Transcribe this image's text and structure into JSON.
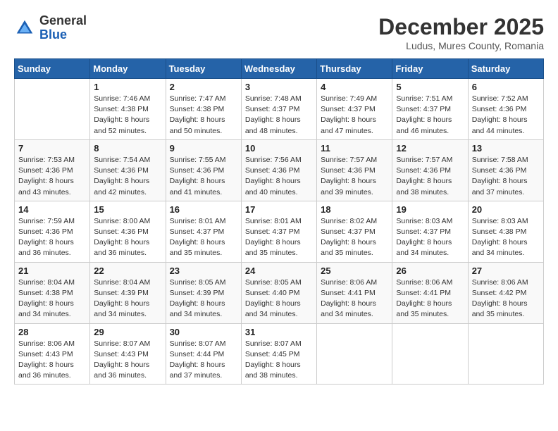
{
  "logo": {
    "general": "General",
    "blue": "Blue"
  },
  "title": {
    "month": "December 2025",
    "location": "Ludus, Mures County, Romania"
  },
  "header_days": [
    "Sunday",
    "Monday",
    "Tuesday",
    "Wednesday",
    "Thursday",
    "Friday",
    "Saturday"
  ],
  "weeks": [
    [
      {
        "day": "",
        "info": ""
      },
      {
        "day": "1",
        "info": "Sunrise: 7:46 AM\nSunset: 4:38 PM\nDaylight: 8 hours\nand 52 minutes."
      },
      {
        "day": "2",
        "info": "Sunrise: 7:47 AM\nSunset: 4:38 PM\nDaylight: 8 hours\nand 50 minutes."
      },
      {
        "day": "3",
        "info": "Sunrise: 7:48 AM\nSunset: 4:37 PM\nDaylight: 8 hours\nand 48 minutes."
      },
      {
        "day": "4",
        "info": "Sunrise: 7:49 AM\nSunset: 4:37 PM\nDaylight: 8 hours\nand 47 minutes."
      },
      {
        "day": "5",
        "info": "Sunrise: 7:51 AM\nSunset: 4:37 PM\nDaylight: 8 hours\nand 46 minutes."
      },
      {
        "day": "6",
        "info": "Sunrise: 7:52 AM\nSunset: 4:36 PM\nDaylight: 8 hours\nand 44 minutes."
      }
    ],
    [
      {
        "day": "7",
        "info": "Sunrise: 7:53 AM\nSunset: 4:36 PM\nDaylight: 8 hours\nand 43 minutes."
      },
      {
        "day": "8",
        "info": "Sunrise: 7:54 AM\nSunset: 4:36 PM\nDaylight: 8 hours\nand 42 minutes."
      },
      {
        "day": "9",
        "info": "Sunrise: 7:55 AM\nSunset: 4:36 PM\nDaylight: 8 hours\nand 41 minutes."
      },
      {
        "day": "10",
        "info": "Sunrise: 7:56 AM\nSunset: 4:36 PM\nDaylight: 8 hours\nand 40 minutes."
      },
      {
        "day": "11",
        "info": "Sunrise: 7:57 AM\nSunset: 4:36 PM\nDaylight: 8 hours\nand 39 minutes."
      },
      {
        "day": "12",
        "info": "Sunrise: 7:57 AM\nSunset: 4:36 PM\nDaylight: 8 hours\nand 38 minutes."
      },
      {
        "day": "13",
        "info": "Sunrise: 7:58 AM\nSunset: 4:36 PM\nDaylight: 8 hours\nand 37 minutes."
      }
    ],
    [
      {
        "day": "14",
        "info": "Sunrise: 7:59 AM\nSunset: 4:36 PM\nDaylight: 8 hours\nand 36 minutes."
      },
      {
        "day": "15",
        "info": "Sunrise: 8:00 AM\nSunset: 4:36 PM\nDaylight: 8 hours\nand 36 minutes."
      },
      {
        "day": "16",
        "info": "Sunrise: 8:01 AM\nSunset: 4:37 PM\nDaylight: 8 hours\nand 35 minutes."
      },
      {
        "day": "17",
        "info": "Sunrise: 8:01 AM\nSunset: 4:37 PM\nDaylight: 8 hours\nand 35 minutes."
      },
      {
        "day": "18",
        "info": "Sunrise: 8:02 AM\nSunset: 4:37 PM\nDaylight: 8 hours\nand 35 minutes."
      },
      {
        "day": "19",
        "info": "Sunrise: 8:03 AM\nSunset: 4:37 PM\nDaylight: 8 hours\nand 34 minutes."
      },
      {
        "day": "20",
        "info": "Sunrise: 8:03 AM\nSunset: 4:38 PM\nDaylight: 8 hours\nand 34 minutes."
      }
    ],
    [
      {
        "day": "21",
        "info": "Sunrise: 8:04 AM\nSunset: 4:38 PM\nDaylight: 8 hours\nand 34 minutes."
      },
      {
        "day": "22",
        "info": "Sunrise: 8:04 AM\nSunset: 4:39 PM\nDaylight: 8 hours\nand 34 minutes."
      },
      {
        "day": "23",
        "info": "Sunrise: 8:05 AM\nSunset: 4:39 PM\nDaylight: 8 hours\nand 34 minutes."
      },
      {
        "day": "24",
        "info": "Sunrise: 8:05 AM\nSunset: 4:40 PM\nDaylight: 8 hours\nand 34 minutes."
      },
      {
        "day": "25",
        "info": "Sunrise: 8:06 AM\nSunset: 4:41 PM\nDaylight: 8 hours\nand 34 minutes."
      },
      {
        "day": "26",
        "info": "Sunrise: 8:06 AM\nSunset: 4:41 PM\nDaylight: 8 hours\nand 35 minutes."
      },
      {
        "day": "27",
        "info": "Sunrise: 8:06 AM\nSunset: 4:42 PM\nDaylight: 8 hours\nand 35 minutes."
      }
    ],
    [
      {
        "day": "28",
        "info": "Sunrise: 8:06 AM\nSunset: 4:43 PM\nDaylight: 8 hours\nand 36 minutes."
      },
      {
        "day": "29",
        "info": "Sunrise: 8:07 AM\nSunset: 4:43 PM\nDaylight: 8 hours\nand 36 minutes."
      },
      {
        "day": "30",
        "info": "Sunrise: 8:07 AM\nSunset: 4:44 PM\nDaylight: 8 hours\nand 37 minutes."
      },
      {
        "day": "31",
        "info": "Sunrise: 8:07 AM\nSunset: 4:45 PM\nDaylight: 8 hours\nand 38 minutes."
      },
      {
        "day": "",
        "info": ""
      },
      {
        "day": "",
        "info": ""
      },
      {
        "day": "",
        "info": ""
      }
    ]
  ]
}
